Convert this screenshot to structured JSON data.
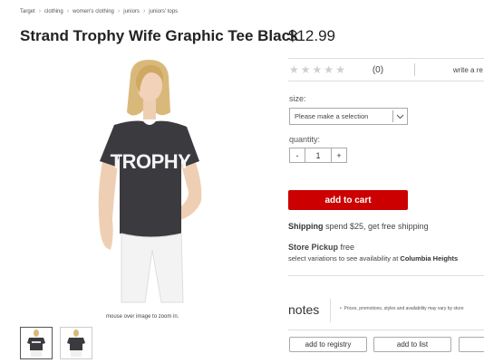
{
  "breadcrumb": [
    "Target",
    "clothing",
    "women's clothing",
    "juniors",
    "juniors' tops"
  ],
  "product": {
    "title": "Strand Trophy Wife Graphic Tee Black",
    "price": "$12.99",
    "shirt_text": "TROPHY"
  },
  "gallery": {
    "zoom_hint": "mouse over image to zoom in.",
    "thumbnails": [
      "front",
      "back"
    ]
  },
  "rating": {
    "stars": 5,
    "filled": 0,
    "count": "(0)",
    "write_review": "write a re"
  },
  "options": {
    "size_label": "size:",
    "size_placeholder": "Please make a selection",
    "quantity_label": "quantity:",
    "quantity_value": "1",
    "minus": "-",
    "plus": "+"
  },
  "cart": {
    "add_label": "add to cart"
  },
  "shipping": {
    "label": "Shipping",
    "text": " spend $25, get free shipping"
  },
  "pickup": {
    "label": "Store Pickup",
    "suffix": " free",
    "sub_text": "select variations to see availability at ",
    "store": "Columbia Heights"
  },
  "notes": {
    "title": "notes",
    "text": "Prices, promotions, styles and availability may vary by store"
  },
  "actions": {
    "registry": "add to registry",
    "list": "add to list"
  },
  "colors": {
    "brand_red": "#cc0000",
    "shirt": "#3a3a3f"
  }
}
